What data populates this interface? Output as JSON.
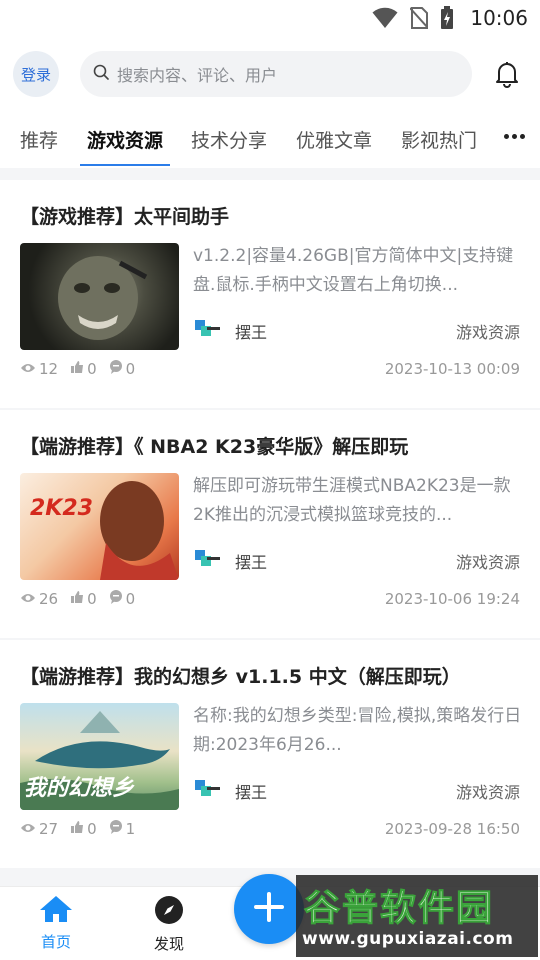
{
  "status_bar": {
    "time": "10:06",
    "icons": [
      "wifi-icon",
      "no-sim-icon",
      "battery-charging-icon"
    ]
  },
  "header": {
    "login_label": "登录",
    "search_placeholder": "搜索内容、评论、用户",
    "bell_icon": "bell-icon"
  },
  "tabs": [
    {
      "label": "推荐",
      "active": false
    },
    {
      "label": "游戏资源",
      "active": true
    },
    {
      "label": "技术分享",
      "active": false
    },
    {
      "label": "优雅文章",
      "active": false
    },
    {
      "label": "影视热门",
      "active": false
    }
  ],
  "more_icon": "more-dots-icon",
  "posts": [
    {
      "title": "【游戏推荐】太平间助手",
      "excerpt": "v1.2.2|容量4.26GB|官方简体中文|支持键盘.鼠标.手柄中文设置右上角切换...",
      "author": "摆王",
      "category": "游戏资源",
      "views": "12",
      "likes": "0",
      "comments": "0",
      "date": "2023-10-13 00:09"
    },
    {
      "title": "【端游推荐】《 NBA2 K23豪华版》解压即玩",
      "excerpt": "解压即可游玩带生涯模式NBA2K23是一款2K推出的沉浸式模拟篮球竞技的...",
      "author": "摆王",
      "category": "游戏资源",
      "views": "26",
      "likes": "0",
      "comments": "0",
      "date": "2023-10-06 19:24",
      "thumb_text": "2K23"
    },
    {
      "title": "【端游推荐】我的幻想乡 v1.1.5 中文（解压即玩）",
      "excerpt": "名称:我的幻想乡类型:冒险,模拟,策略发行日期:2023年6月26...",
      "author": "摆王",
      "category": "游戏资源",
      "views": "27",
      "likes": "0",
      "comments": "1",
      "date": "2023-09-28 16:50",
      "thumb_text": "我的幻想乡"
    }
  ],
  "bottom_nav": {
    "home_label": "首页",
    "discover_label": "发现",
    "accent_color": "#1a8df5"
  },
  "watermark": {
    "top": "谷普软件园",
    "bottom": "www.gupuxiazai.com"
  }
}
